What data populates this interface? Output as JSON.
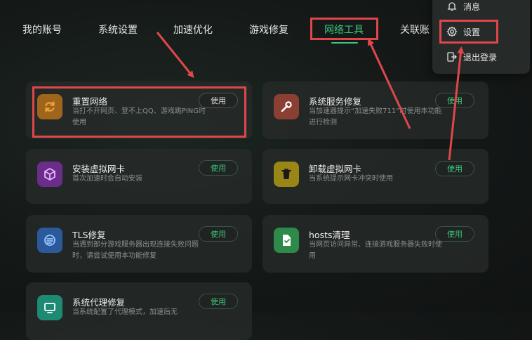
{
  "nav": {
    "tabs": [
      {
        "label": "我的账号"
      },
      {
        "label": "系统设置"
      },
      {
        "label": "加速优化"
      },
      {
        "label": "游戏修复"
      },
      {
        "label": "网络工具",
        "active": true
      },
      {
        "label": "关联账"
      }
    ]
  },
  "dropdown": {
    "items": [
      {
        "label": "消息",
        "icon": "bell-icon"
      },
      {
        "label": "设置",
        "icon": "gear-icon"
      },
      {
        "label": "退出登录",
        "icon": "logout-icon"
      }
    ]
  },
  "cards": [
    {
      "title": "重置网络",
      "desc": "当打不开网页、登不上QQ、游戏跳PING时使用",
      "button": "使用",
      "icon": "refresh-icon",
      "color": "#a0651d"
    },
    {
      "title": "系统服务修复",
      "desc": "当加速器提示“加速失败711”时使用本功能进行检测",
      "button": "使用",
      "icon": "wrench-icon",
      "color": "#8a3f33"
    },
    {
      "title": "安装虚拟网卡",
      "desc": "首次加速时会自动安装",
      "button": "使用",
      "icon": "cube-icon",
      "color": "#6b2d8a"
    },
    {
      "title": "卸载虚拟网卡",
      "desc": "当系统提示网卡冲突时使用",
      "button": "使用",
      "icon": "trash-icon",
      "color": "#9a8616"
    },
    {
      "title": "TLS修复",
      "desc": "当遇到部分游戏服务器出现连接失败问题时，请尝试使用本功能修复",
      "button": "使用",
      "icon": "tls-icon",
      "color": "#2b5a9c"
    },
    {
      "title": "hosts清理",
      "desc": "当网页访问异常、连接游戏服务器失败时使用",
      "button": "使用",
      "icon": "doc-icon",
      "color": "#2d8a48"
    },
    {
      "title": "系统代理修复",
      "desc": "当系统配置了代理模式，加速后无",
      "button": "使用",
      "icon": "monitor-icon",
      "color": "#1d8a73"
    }
  ],
  "colors": {
    "accent": "#3cc47a",
    "highlight": "#e0474a"
  }
}
